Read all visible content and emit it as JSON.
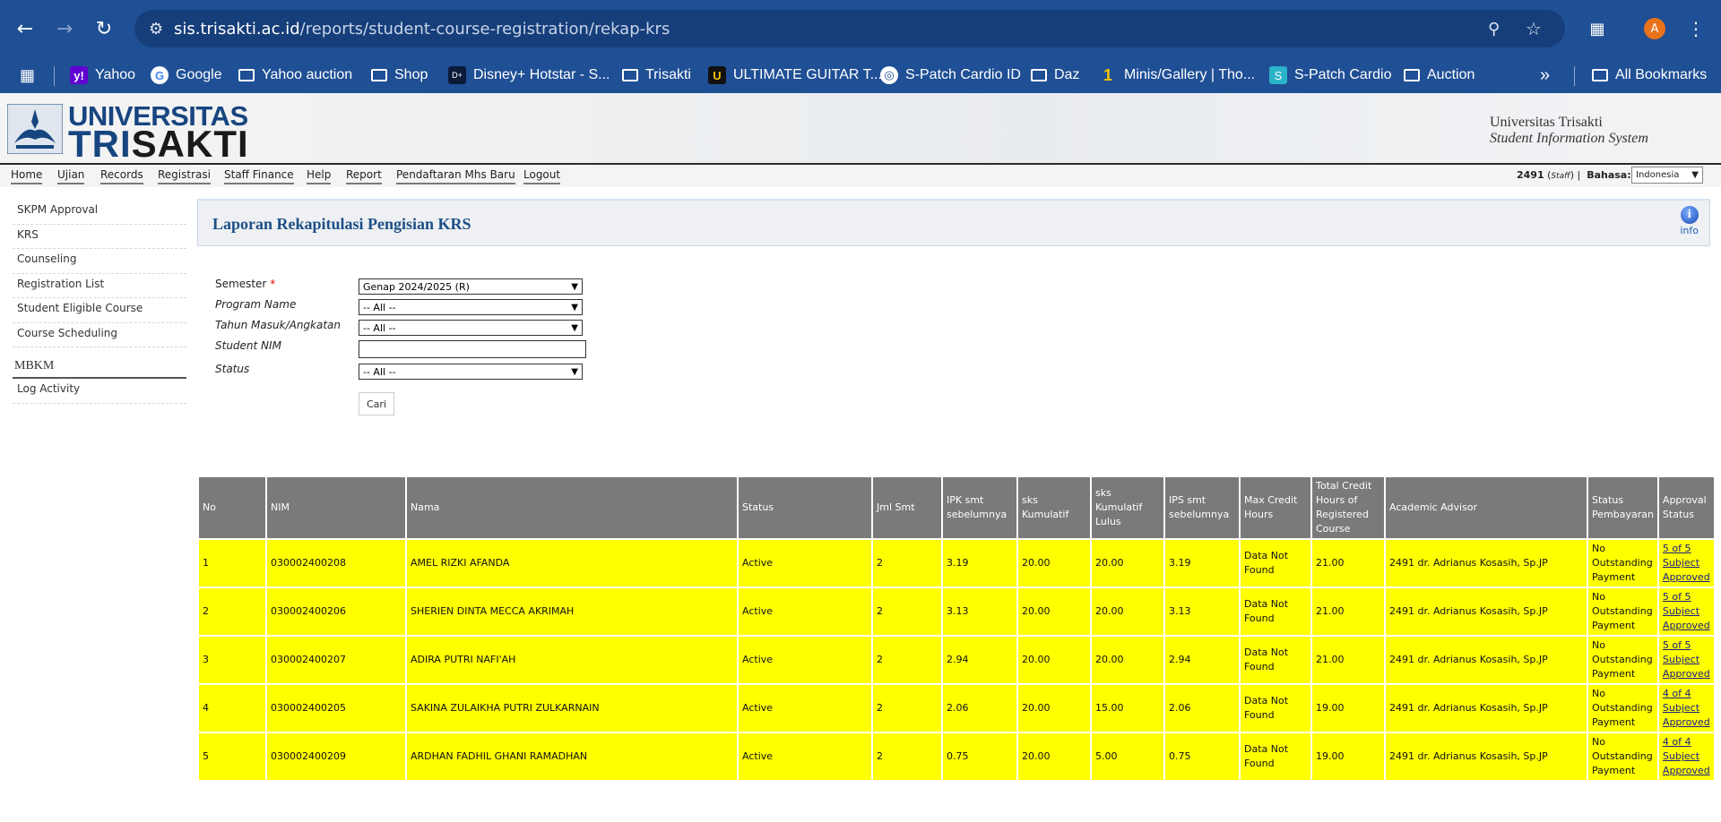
{
  "browser": {
    "url_host": "sis.trisakti.ac.id",
    "url_path": "/reports/student-course-registration/rekap-krs",
    "profile_initial": "A",
    "bookmarks": [
      "Yahoo",
      "Google",
      "Yahoo auction",
      "Shop",
      "Disney+ Hotstar - S...",
      "Trisakti",
      "ULTIMATE GUITAR T...",
      "S-Patch Cardio ID",
      "Daz",
      "Minis/Gallery | Tho...",
      "S-Patch Cardio",
      "Auction"
    ],
    "all_bookmarks": "All Bookmarks",
    "overflow": "»"
  },
  "site": {
    "logo_line1": "UNIVERSITAS",
    "logo_tri": "TRI",
    "logo_sakti": "SAKTI",
    "uni_name": "Universitas Trisakti",
    "system_name": "Student Information System"
  },
  "menu": [
    "Home",
    "Ujian",
    "Records",
    "Registrasi",
    "Staff Finance",
    "Help",
    "Report",
    "Pendaftaran Mhs Baru",
    "Logout"
  ],
  "user": {
    "id": "2491",
    "role": "Staff",
    "lang_label": "Bahasa:",
    "lang_value": "Indonesia"
  },
  "sidebar": {
    "items": [
      "SKPM Approval",
      "KRS",
      "Counseling",
      "Registration List",
      "Student Eligible Course",
      "Course Scheduling"
    ],
    "section": "MBKM",
    "section_items": [
      "Log Activity"
    ]
  },
  "page": {
    "title": "Laporan Rekapitulasi Pengisian KRS",
    "info_label": "info"
  },
  "form": {
    "semester_label": "Semester",
    "semester_value": "Genap 2024/2025 (R)",
    "program_label": "Program Name",
    "program_value": "-- All --",
    "tahun_label": "Tahun Masuk/Angkatan",
    "tahun_value": "-- All --",
    "nim_label": "Student NIM",
    "nim_value": "",
    "status_label": "Status",
    "status_value": "-- All --",
    "search_button": "Cari"
  },
  "table": {
    "headers": [
      "No",
      "NIM",
      "Nama",
      "Status",
      "Jml Smt",
      "IPK smt sebelumnya",
      "sks Kumulatif",
      "sks Kumulatif Lulus",
      "IPS smt sebelumnya",
      "Max Credit Hours",
      "Total Credit Hours of Registered Course",
      "Academic Advisor",
      "Status Pembayaran",
      "Approval Status"
    ],
    "rows": [
      [
        "1",
        "030002400208",
        "AMEL RIZKI AFANDA",
        "Active",
        "2",
        "3.19",
        "20.00",
        "20.00",
        "3.19",
        "Data Not Found",
        "21.00",
        "2491 dr. Adrianus Kosasih, Sp.JP",
        "No Outstanding Payment",
        "5 of 5 Subject Approved"
      ],
      [
        "2",
        "030002400206",
        "SHERIEN DINTA MECCA AKRIMAH",
        "Active",
        "2",
        "3.13",
        "20.00",
        "20.00",
        "3.13",
        "Data Not Found",
        "21.00",
        "2491 dr. Adrianus Kosasih, Sp.JP",
        "No Outstanding Payment",
        "5 of 5 Subject Approved"
      ],
      [
        "3",
        "030002400207",
        "ADIRA PUTRI NAFI'AH",
        "Active",
        "2",
        "2.94",
        "20.00",
        "20.00",
        "2.94",
        "Data Not Found",
        "21.00",
        "2491 dr. Adrianus Kosasih, Sp.JP",
        "No Outstanding Payment",
        "5 of 5 Subject Approved"
      ],
      [
        "4",
        "030002400205",
        "SAKINA ZULAIKHA PUTRI ZULKARNAIN",
        "Active",
        "2",
        "2.06",
        "20.00",
        "15.00",
        "2.06",
        "Data Not Found",
        "19.00",
        "2491 dr. Adrianus Kosasih, Sp.JP",
        "No Outstanding Payment",
        "4 of 4 Subject Approved"
      ],
      [
        "5",
        "030002400209",
        "ARDHAN FADHIL GHANI RAMADHAN",
        "Active",
        "2",
        "0.75",
        "20.00",
        "5.00",
        "0.75",
        "Data Not Found",
        "19.00",
        "2491 dr. Adrianus Kosasih, Sp.JP",
        "No Outstanding Payment",
        "4 of 4 Subject Approved"
      ]
    ]
  }
}
